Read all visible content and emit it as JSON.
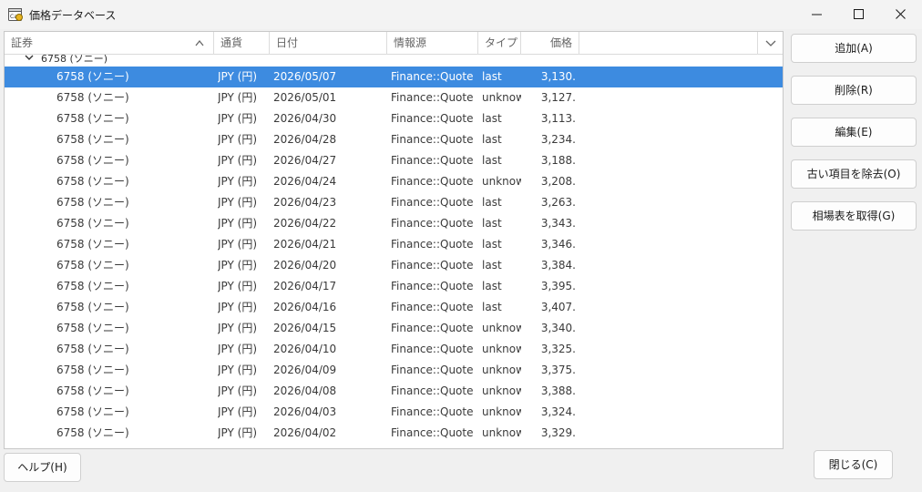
{
  "window": {
    "title": "価格データベース",
    "buttons": [
      "minimize-icon",
      "maximize-icon",
      "close-icon"
    ]
  },
  "table": {
    "columns": {
      "security": "証券",
      "currency": "通貨",
      "date": "日付",
      "source": "情報源",
      "type": "タイプ",
      "price": "価格"
    },
    "group": "6758 (ソニー)",
    "rows": [
      {
        "security": "6758 (ソニー)",
        "currency": "JPY (円)",
        "date": "2026/05/07",
        "source": "Finance::Quote",
        "type": "last",
        "price": "3,130."
      },
      {
        "security": "6758 (ソニー)",
        "currency": "JPY (円)",
        "date": "2026/05/01",
        "source": "Finance::Quote",
        "type": "unknow",
        "price": "3,127."
      },
      {
        "security": "6758 (ソニー)",
        "currency": "JPY (円)",
        "date": "2026/04/30",
        "source": "Finance::Quote",
        "type": "last",
        "price": "3,113."
      },
      {
        "security": "6758 (ソニー)",
        "currency": "JPY (円)",
        "date": "2026/04/28",
        "source": "Finance::Quote",
        "type": "last",
        "price": "3,234."
      },
      {
        "security": "6758 (ソニー)",
        "currency": "JPY (円)",
        "date": "2026/04/27",
        "source": "Finance::Quote",
        "type": "last",
        "price": "3,188."
      },
      {
        "security": "6758 (ソニー)",
        "currency": "JPY (円)",
        "date": "2026/04/24",
        "source": "Finance::Quote",
        "type": "unknow",
        "price": "3,208."
      },
      {
        "security": "6758 (ソニー)",
        "currency": "JPY (円)",
        "date": "2026/04/23",
        "source": "Finance::Quote",
        "type": "last",
        "price": "3,263."
      },
      {
        "security": "6758 (ソニー)",
        "currency": "JPY (円)",
        "date": "2026/04/22",
        "source": "Finance::Quote",
        "type": "last",
        "price": "3,343."
      },
      {
        "security": "6758 (ソニー)",
        "currency": "JPY (円)",
        "date": "2026/04/21",
        "source": "Finance::Quote",
        "type": "last",
        "price": "3,346."
      },
      {
        "security": "6758 (ソニー)",
        "currency": "JPY (円)",
        "date": "2026/04/20",
        "source": "Finance::Quote",
        "type": "last",
        "price": "3,384."
      },
      {
        "security": "6758 (ソニー)",
        "currency": "JPY (円)",
        "date": "2026/04/17",
        "source": "Finance::Quote",
        "type": "last",
        "price": "3,395."
      },
      {
        "security": "6758 (ソニー)",
        "currency": "JPY (円)",
        "date": "2026/04/16",
        "source": "Finance::Quote",
        "type": "last",
        "price": "3,407."
      },
      {
        "security": "6758 (ソニー)",
        "currency": "JPY (円)",
        "date": "2026/04/15",
        "source": "Finance::Quote",
        "type": "unknow",
        "price": "3,340."
      },
      {
        "security": "6758 (ソニー)",
        "currency": "JPY (円)",
        "date": "2026/04/10",
        "source": "Finance::Quote",
        "type": "unknow",
        "price": "3,325."
      },
      {
        "security": "6758 (ソニー)",
        "currency": "JPY (円)",
        "date": "2026/04/09",
        "source": "Finance::Quote",
        "type": "unknow",
        "price": "3,375."
      },
      {
        "security": "6758 (ソニー)",
        "currency": "JPY (円)",
        "date": "2026/04/08",
        "source": "Finance::Quote",
        "type": "unknow",
        "price": "3,388."
      },
      {
        "security": "6758 (ソニー)",
        "currency": "JPY (円)",
        "date": "2026/04/03",
        "source": "Finance::Quote",
        "type": "unknow",
        "price": "3,324."
      },
      {
        "security": "6758 (ソニー)",
        "currency": "JPY (円)",
        "date": "2026/04/02",
        "source": "Finance::Quote",
        "type": "unknow",
        "price": "3,329."
      }
    ],
    "selected_row": 0,
    "selection_color": "#3d8be0"
  },
  "buttons": {
    "add": "追加(A)",
    "remove": "削除(R)",
    "edit": "編集(E)",
    "remove_old": "古い項目を除去(O)",
    "get_quotes": "相場表を取得(G)",
    "help": "ヘルプ(H)",
    "close": "閉じる(C)"
  }
}
